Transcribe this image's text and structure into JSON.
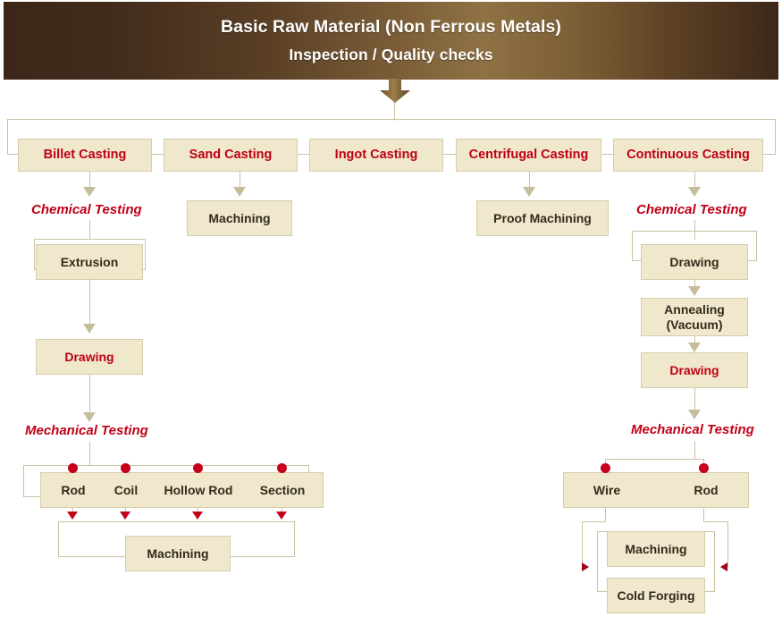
{
  "header": {
    "title_line1": "Basic Raw Material (Non Ferrous Metals)",
    "title_line2": "Inspection / Quality checks",
    "gradient_dark": "#3b2618",
    "gradient_light": "#8e7244",
    "text_color": "#ffffff"
  },
  "theme": {
    "node_fill": "#f0e8cc",
    "node_border": "#d6cda8",
    "connector": "#c9c2a4",
    "accent_red": "#c00016",
    "marker_red": "#c4001a",
    "label_dark": "#332a1c"
  },
  "casting_row": [
    {
      "label": "Billet Casting"
    },
    {
      "label": "Sand Casting"
    },
    {
      "label": "Ingot Casting"
    },
    {
      "label": "Centrifugal Casting"
    },
    {
      "label": "Continuous Casting"
    }
  ],
  "billet_branch": {
    "test_chemical": "Chemical Testing",
    "extrusion": "Extrusion",
    "drawing": "Drawing",
    "test_mechanical": "Mechanical  Testing",
    "outputs": [
      "Rod",
      "Coil",
      "Hollow Rod",
      "Section"
    ],
    "machining": "Machining"
  },
  "sand_branch": {
    "machining": "Machining"
  },
  "centrifugal_branch": {
    "proof_machining": "Proof Machining"
  },
  "continuous_branch": {
    "test_chemical": "Chemical Testing",
    "drawing_1": "Drawing",
    "annealing_line1": "Annealing",
    "annealing_line2": "(Vacuum)",
    "drawing_2": "Drawing",
    "test_mechanical": "Mechanical  Testing",
    "outputs": [
      "Wire",
      "Rod"
    ],
    "machining": "Machining",
    "cold_forging": "Cold Forging"
  },
  "icons": {
    "flow_arrow": "down-arrow-icon",
    "branch_dot": "branch-dot-icon",
    "branch_arrow_down": "red-down-arrow-icon",
    "branch_arrow_right": "red-right-arrow-icon",
    "branch_arrow_left": "red-left-arrow-icon"
  }
}
